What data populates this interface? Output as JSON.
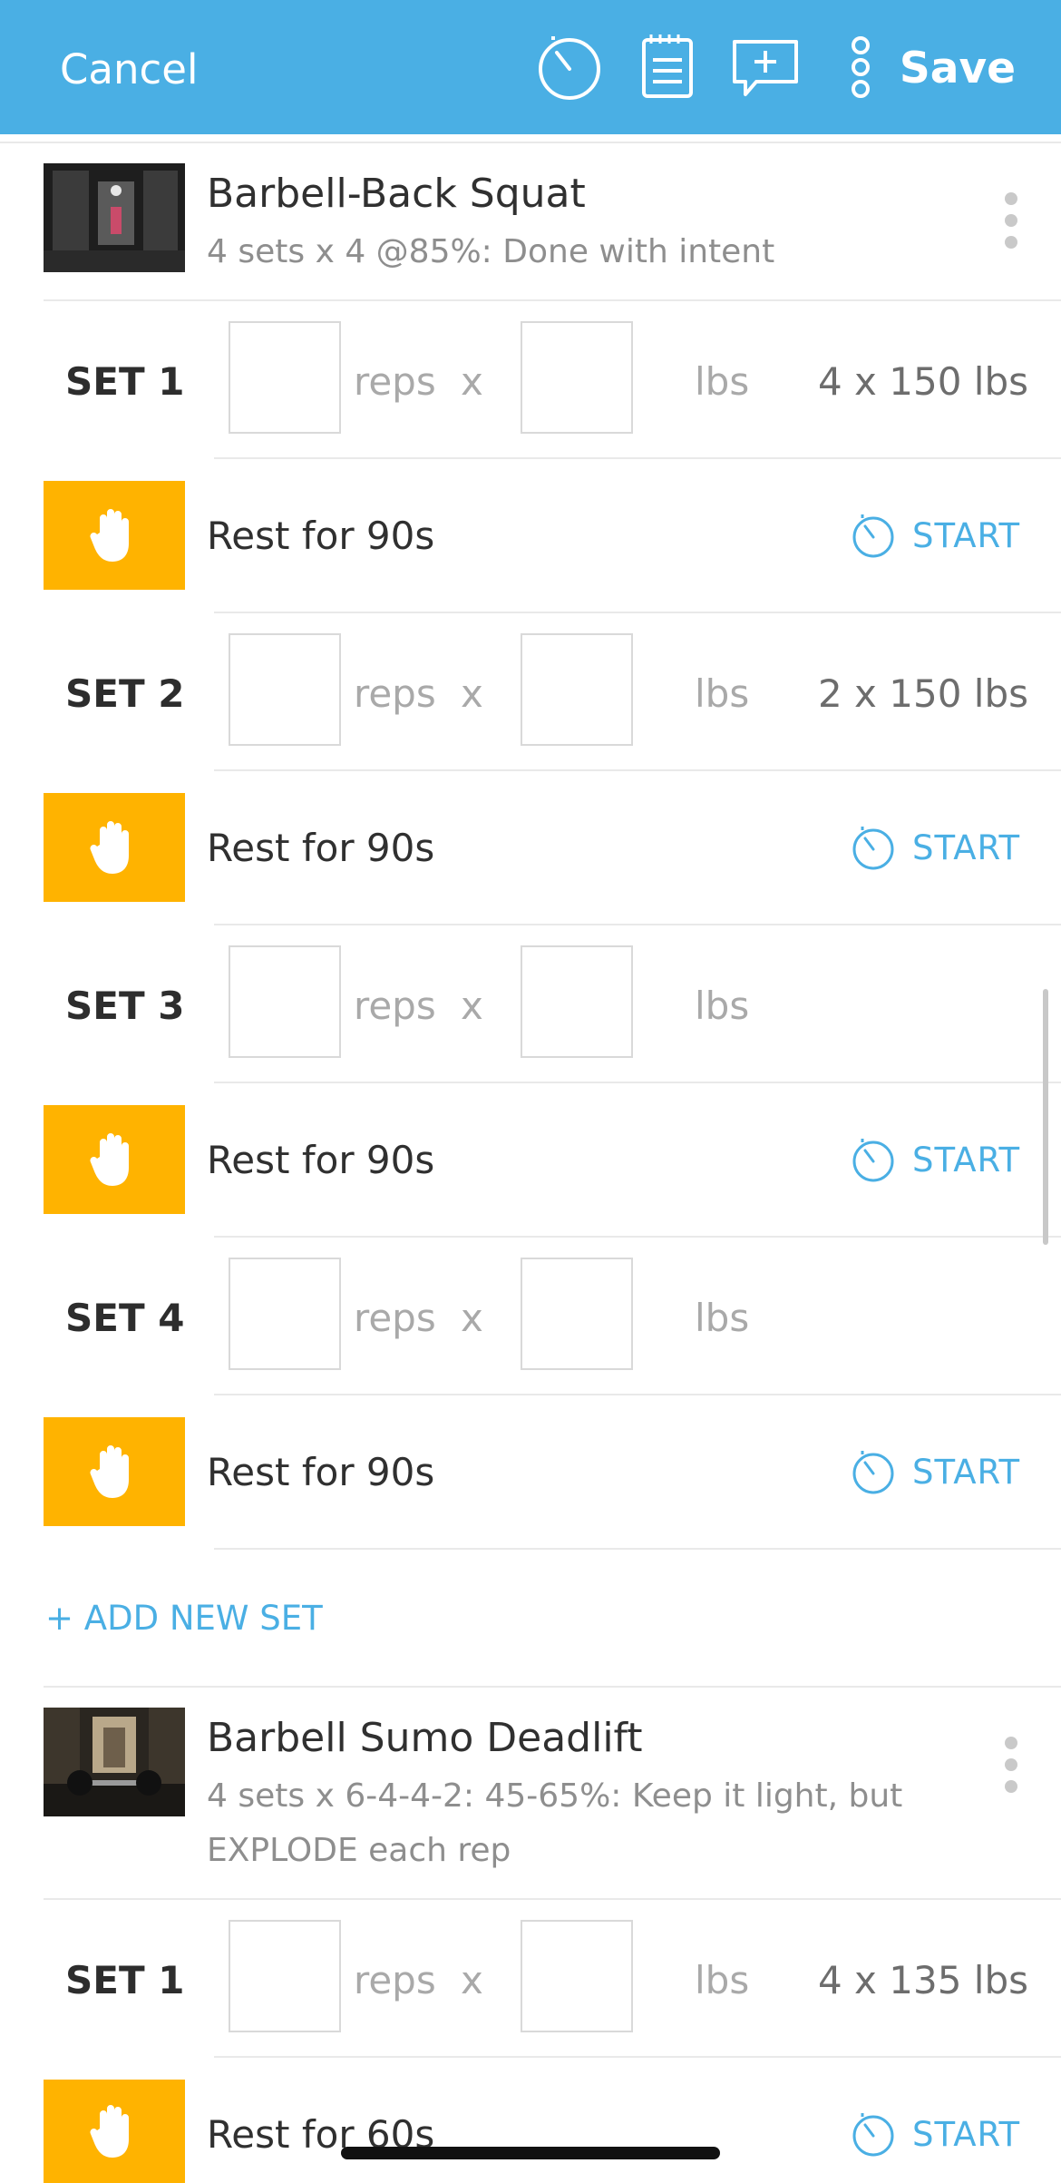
{
  "header": {
    "cancel_label": "Cancel",
    "save_label": "Save",
    "icons": [
      "stopwatch-icon",
      "notes-icon",
      "add-comment-icon",
      "more-vertical-icon"
    ],
    "bg_color": "#4aafe4"
  },
  "exercises": [
    {
      "name": "Barbell-Back Squat",
      "description": "4 sets x 4 @85%: Done with intent",
      "sets": [
        {
          "label": "SET 1",
          "reps_unit": "reps",
          "x": "x",
          "weight_unit": "lbs",
          "previous": "4 x 150 lbs",
          "rest": "Rest for 90s",
          "start": "START"
        },
        {
          "label": "SET 2",
          "reps_unit": "reps",
          "x": "x",
          "weight_unit": "lbs",
          "previous": "2 x 150 lbs",
          "rest": "Rest for 90s",
          "start": "START"
        },
        {
          "label": "SET 3",
          "reps_unit": "reps",
          "x": "x",
          "weight_unit": "lbs",
          "previous": "",
          "rest": "Rest for 90s",
          "start": "START"
        },
        {
          "label": "SET 4",
          "reps_unit": "reps",
          "x": "x",
          "weight_unit": "lbs",
          "previous": "",
          "rest": "Rest for 90s",
          "start": "START"
        }
      ],
      "add_set_label": "+ ADD NEW SET"
    },
    {
      "name": "Barbell Sumo Deadlift",
      "description": "4 sets x 6-4-4-2: 45-65%: Keep it light, but EXPLODE each rep",
      "sets": [
        {
          "label": "SET 1",
          "reps_unit": "reps",
          "x": "x",
          "weight_unit": "lbs",
          "previous": "4 x 135 lbs",
          "rest": "Rest for 60s",
          "start": "START"
        }
      ]
    }
  ],
  "colors": {
    "accent": "#4aafe4",
    "rest_tile": "#ffb300"
  }
}
